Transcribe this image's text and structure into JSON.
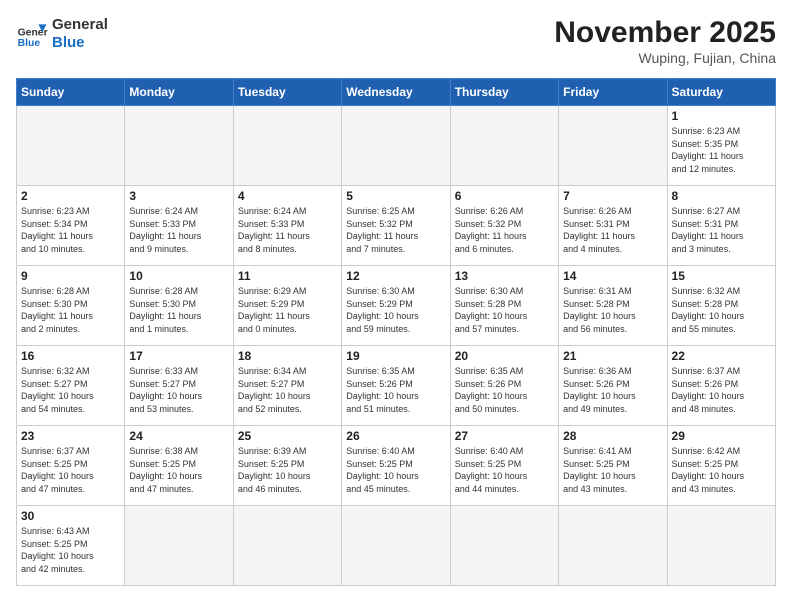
{
  "header": {
    "logo_general": "General",
    "logo_blue": "Blue",
    "month_year": "November 2025",
    "location": "Wuping, Fujian, China"
  },
  "weekdays": [
    "Sunday",
    "Monday",
    "Tuesday",
    "Wednesday",
    "Thursday",
    "Friday",
    "Saturday"
  ],
  "days": {
    "d1": {
      "n": "1",
      "rise": "6:23 AM",
      "set": "5:35 PM",
      "hours": "11",
      "mins": "12"
    },
    "d2": {
      "n": "2",
      "rise": "6:23 AM",
      "set": "5:34 PM",
      "hours": "11",
      "mins": "10"
    },
    "d3": {
      "n": "3",
      "rise": "6:24 AM",
      "set": "5:33 PM",
      "hours": "11",
      "mins": "9"
    },
    "d4": {
      "n": "4",
      "rise": "6:24 AM",
      "set": "5:33 PM",
      "hours": "11",
      "mins": "8"
    },
    "d5": {
      "n": "5",
      "rise": "6:25 AM",
      "set": "5:32 PM",
      "hours": "11",
      "mins": "7"
    },
    "d6": {
      "n": "6",
      "rise": "6:26 AM",
      "set": "5:32 PM",
      "hours": "11",
      "mins": "6"
    },
    "d7": {
      "n": "7",
      "rise": "6:26 AM",
      "set": "5:31 PM",
      "hours": "11",
      "mins": "4"
    },
    "d8": {
      "n": "8",
      "rise": "6:27 AM",
      "set": "5:31 PM",
      "hours": "11",
      "mins": "3"
    },
    "d9": {
      "n": "9",
      "rise": "6:28 AM",
      "set": "5:30 PM",
      "hours": "11",
      "mins": "2"
    },
    "d10": {
      "n": "10",
      "rise": "6:28 AM",
      "set": "5:30 PM",
      "hours": "11",
      "mins": "1"
    },
    "d11": {
      "n": "11",
      "rise": "6:29 AM",
      "set": "5:29 PM",
      "hours": "11",
      "mins": "0"
    },
    "d12": {
      "n": "12",
      "rise": "6:30 AM",
      "set": "5:29 PM",
      "hours": "10",
      "mins": "59"
    },
    "d13": {
      "n": "13",
      "rise": "6:30 AM",
      "set": "5:28 PM",
      "hours": "10",
      "mins": "57"
    },
    "d14": {
      "n": "14",
      "rise": "6:31 AM",
      "set": "5:28 PM",
      "hours": "10",
      "mins": "56"
    },
    "d15": {
      "n": "15",
      "rise": "6:32 AM",
      "set": "5:28 PM",
      "hours": "10",
      "mins": "55"
    },
    "d16": {
      "n": "16",
      "rise": "6:32 AM",
      "set": "5:27 PM",
      "hours": "10",
      "mins": "54"
    },
    "d17": {
      "n": "17",
      "rise": "6:33 AM",
      "set": "5:27 PM",
      "hours": "10",
      "mins": "53"
    },
    "d18": {
      "n": "18",
      "rise": "6:34 AM",
      "set": "5:27 PM",
      "hours": "10",
      "mins": "52"
    },
    "d19": {
      "n": "19",
      "rise": "6:35 AM",
      "set": "5:26 PM",
      "hours": "10",
      "mins": "51"
    },
    "d20": {
      "n": "20",
      "rise": "6:35 AM",
      "set": "5:26 PM",
      "hours": "10",
      "mins": "50"
    },
    "d21": {
      "n": "21",
      "rise": "6:36 AM",
      "set": "5:26 PM",
      "hours": "10",
      "mins": "49"
    },
    "d22": {
      "n": "22",
      "rise": "6:37 AM",
      "set": "5:26 PM",
      "hours": "10",
      "mins": "48"
    },
    "d23": {
      "n": "23",
      "rise": "6:37 AM",
      "set": "5:25 PM",
      "hours": "10",
      "mins": "47"
    },
    "d24": {
      "n": "24",
      "rise": "6:38 AM",
      "set": "5:25 PM",
      "hours": "10",
      "mins": "47"
    },
    "d25": {
      "n": "25",
      "rise": "6:39 AM",
      "set": "5:25 PM",
      "hours": "10",
      "mins": "46"
    },
    "d26": {
      "n": "26",
      "rise": "6:40 AM",
      "set": "5:25 PM",
      "hours": "10",
      "mins": "45"
    },
    "d27": {
      "n": "27",
      "rise": "6:40 AM",
      "set": "5:25 PM",
      "hours": "10",
      "mins": "44"
    },
    "d28": {
      "n": "28",
      "rise": "6:41 AM",
      "set": "5:25 PM",
      "hours": "10",
      "mins": "43"
    },
    "d29": {
      "n": "29",
      "rise": "6:42 AM",
      "set": "5:25 PM",
      "hours": "10",
      "mins": "43"
    },
    "d30": {
      "n": "30",
      "rise": "6:43 AM",
      "set": "5:25 PM",
      "hours": "10",
      "mins": "42"
    }
  }
}
